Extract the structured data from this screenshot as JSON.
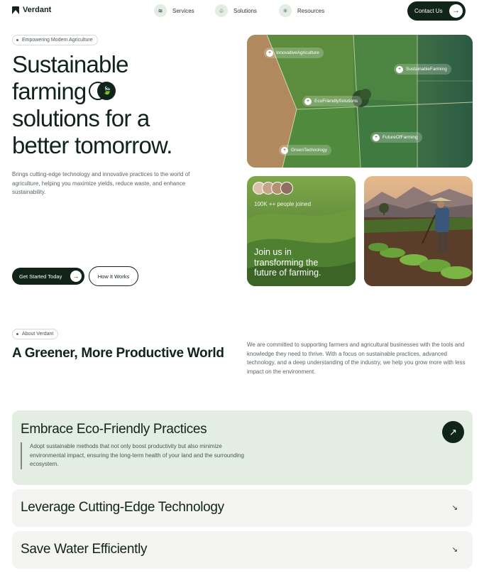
{
  "nav": {
    "brand": "Verdant",
    "links": [
      {
        "label": "Services",
        "icon": "layers-icon",
        "glyph": "≋"
      },
      {
        "label": "Solutions",
        "icon": "plant-icon",
        "glyph": "♧"
      },
      {
        "label": "Resources",
        "icon": "atom-icon",
        "glyph": "⚛"
      }
    ],
    "contact_label": "Contact Us"
  },
  "hero": {
    "badge": "Empowering Modern Agriculture",
    "title_line1": "Sustainable",
    "title_line2": "farming",
    "title_line3": "solutions for a",
    "title_line4": "better tomorrow.",
    "description": "Brings cutting-edge technology and innovative practices to the world of agriculture, helping you maximize yields, reduce waste, and enhance sustainability.",
    "cta_primary": "Get Started Today",
    "cta_secondary": "How It Works"
  },
  "aerial_tags": [
    "InnovativeAgriculture",
    "SustainableFarming",
    "EcoFriendlySolutions",
    "FutureOfFarming",
    "GreenTechnology"
  ],
  "join_card": {
    "count_text": "100K ++ people joined",
    "heading": "Join us in transforming the future of farming."
  },
  "about": {
    "badge": "About Verdant",
    "title": "A Greener, More Productive World",
    "description": "We are committed to supporting farmers and agricultural businesses with the tools and knowledge they need to thrive. With a focus on sustainable practices, advanced technology, and a deep understanding of the industry, we help you grow more with less impact on the environment."
  },
  "accordion": [
    {
      "title": "Embrace Eco-Friendly Practices",
      "description": "Adopt sustainable methods that not only boost productivity but also minimize environmental impact, ensuring the long-term health of your land and the surrounding ecosystem.",
      "open": true
    },
    {
      "title": "Leverage Cutting-Edge Technology",
      "open": false
    },
    {
      "title": "Save Water Efficiently",
      "open": false
    }
  ],
  "colors": {
    "brand_dark": "#10241a",
    "accordion_open_bg": "#e3ede1",
    "accordion_closed_bg": "#f4f4f3"
  }
}
